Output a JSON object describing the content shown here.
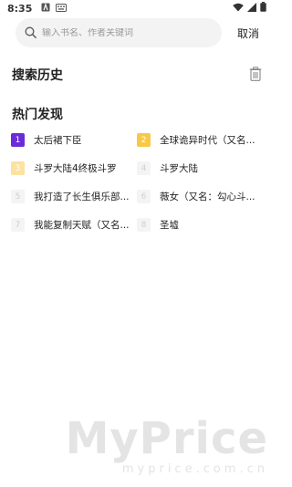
{
  "status_bar": {
    "time": "8:35",
    "icons": [
      "notification-a-icon",
      "keyboard-icon",
      "wifi-icon",
      "signal-icon",
      "battery-icon"
    ]
  },
  "search": {
    "placeholder": "输入书名、作者关键词",
    "cancel_label": "取消"
  },
  "history": {
    "title": "搜索历史",
    "delete_icon": "trash-icon"
  },
  "hot": {
    "title": "热门发现",
    "items": [
      {
        "rank": "1",
        "name": "太后裙下臣"
      },
      {
        "rank": "2",
        "name": "全球诡异时代（又名..."
      },
      {
        "rank": "3",
        "name": "斗罗大陆4终极斗罗"
      },
      {
        "rank": "4",
        "name": "斗罗大陆"
      },
      {
        "rank": "5",
        "name": "我打造了长生俱乐部..."
      },
      {
        "rank": "6",
        "name": "薇女（又名：勾心斗..."
      },
      {
        "rank": "7",
        "name": "我能复制天赋（又名..."
      },
      {
        "rank": "8",
        "name": "圣墟"
      }
    ]
  },
  "watermark": {
    "big": "MyPrice",
    "small": "myprice.com.cn"
  },
  "colors": {
    "rank1": "#6c2bd9",
    "rank2": "#f7c948",
    "rank3": "#fce2a1",
    "rank_default": "#f4f4f4"
  }
}
